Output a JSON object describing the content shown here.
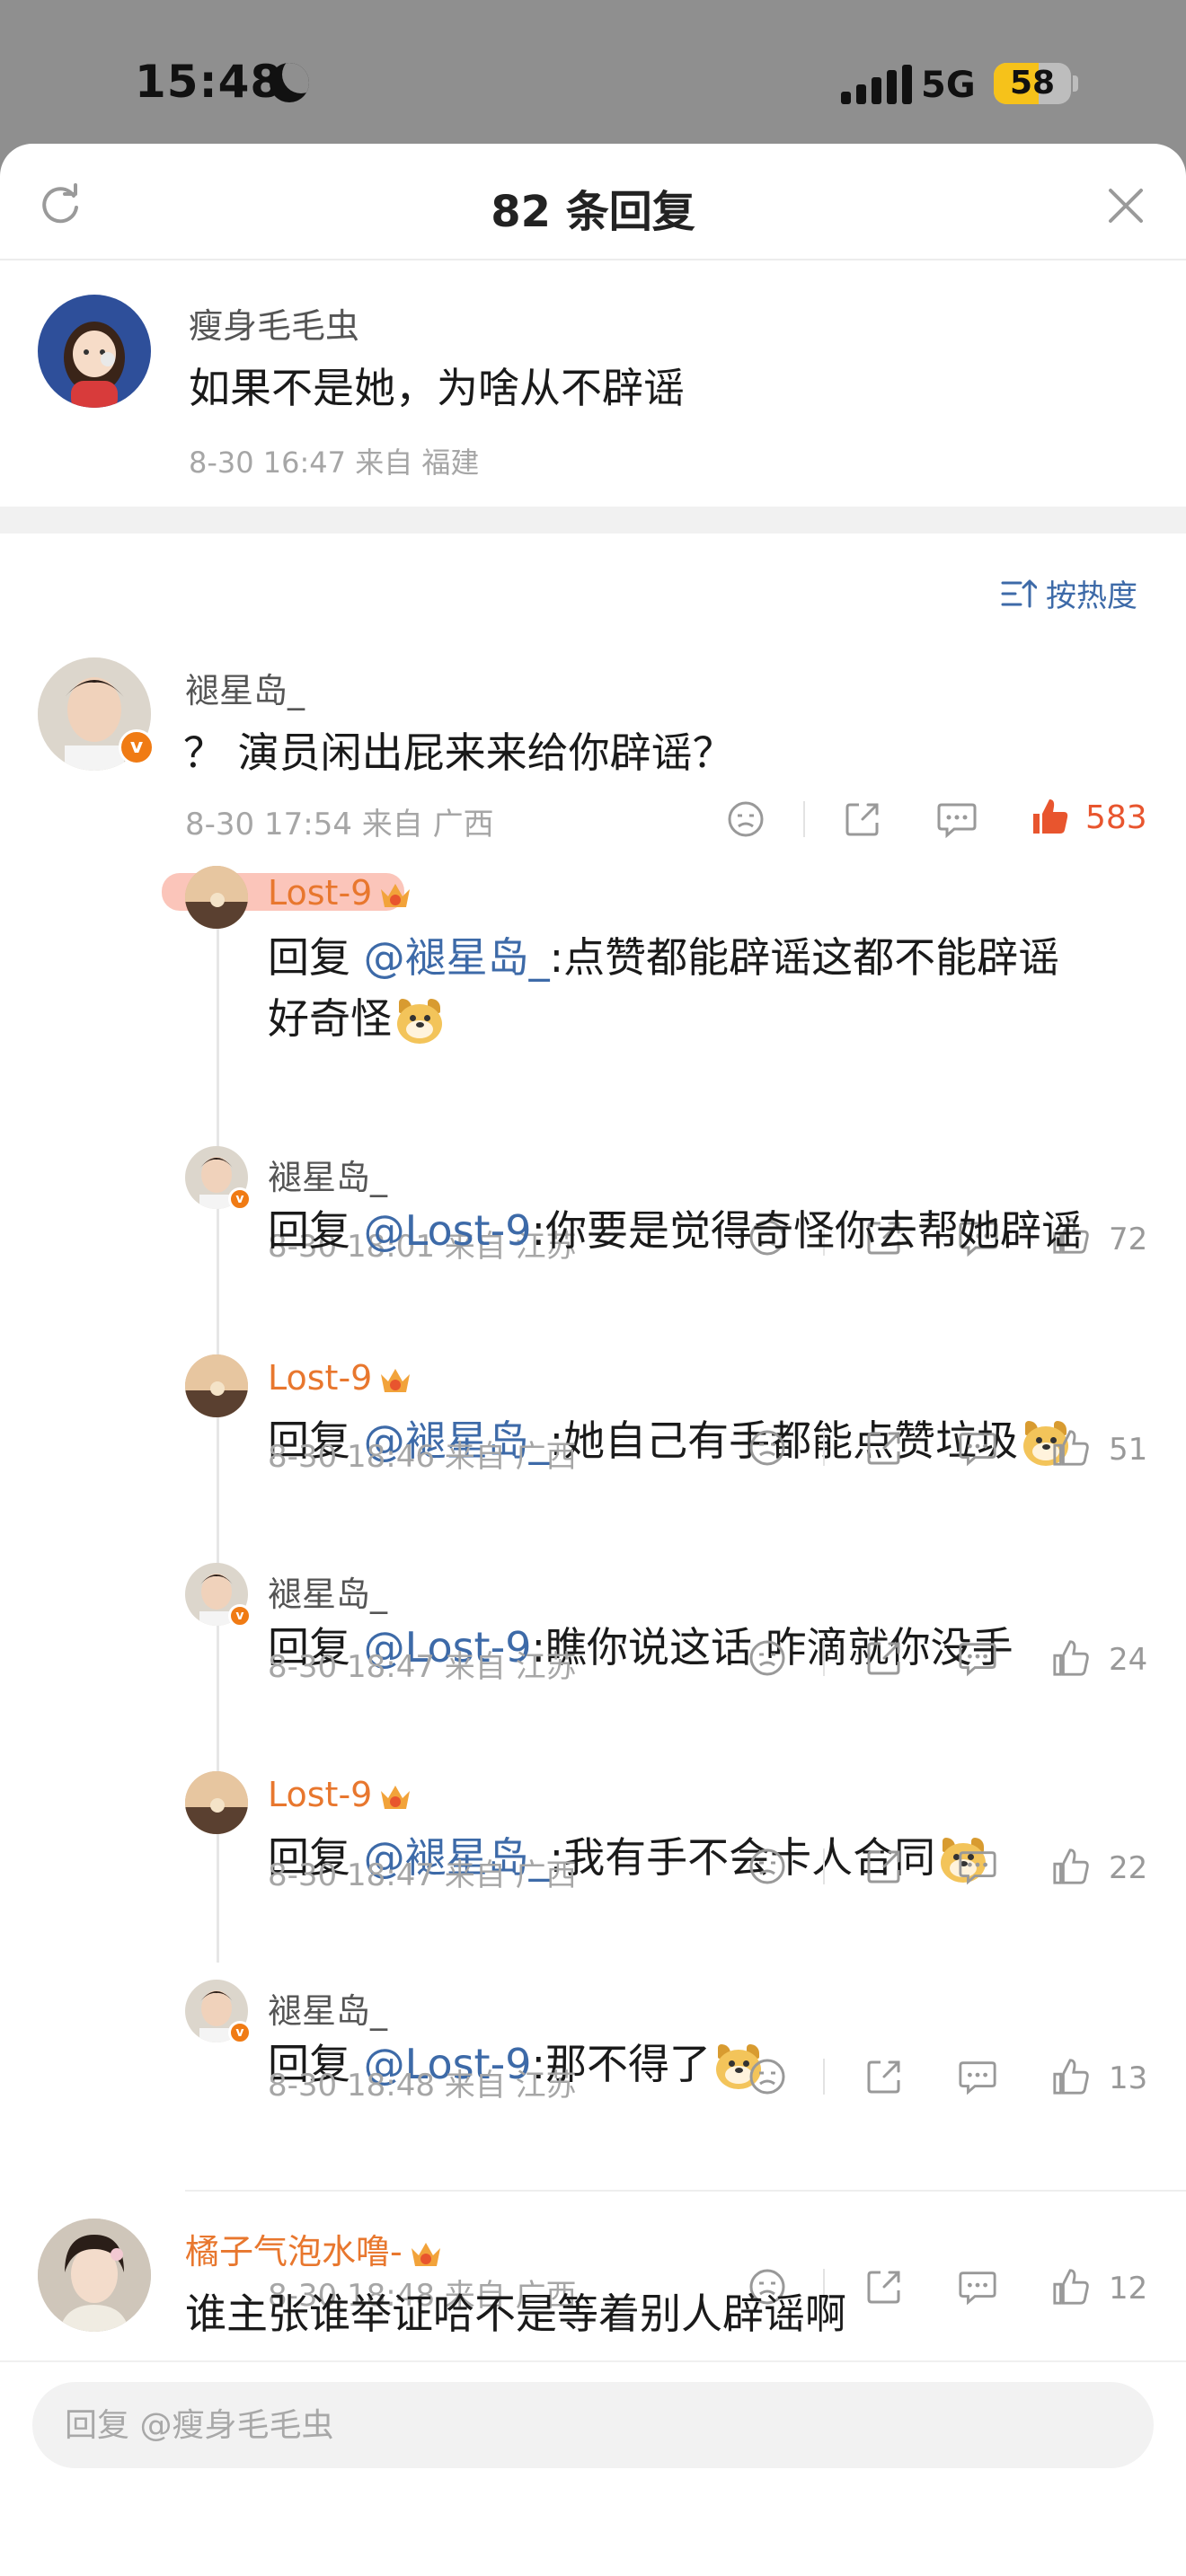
{
  "status_bar": {
    "time": "15:48",
    "network": "5G",
    "battery": "58",
    "battery_level": 0.58
  },
  "header": {
    "title": "82 条回复"
  },
  "root_comment": {
    "user": "瘦身毛毛虫",
    "text": "如果不是她，为啥从不辟谣",
    "meta": "8-30 16:47 来自 福建"
  },
  "sort": {
    "label": "按热度"
  },
  "top_comment": {
    "user": "褪星岛_",
    "text": "？ 演员闲出屁来来给你辟谣？",
    "meta": "8-30 17:54 来自 广西",
    "likes": "583"
  },
  "replies": [
    {
      "user": "Lost-9",
      "prefix": "回复 ",
      "at": "@褪星岛_",
      "text_line1": ":点赞都能辟谣这都不能辟谣",
      "text_line2": "好奇怪",
      "meta": "8-30 18:01 来自 江苏",
      "likes": "72"
    },
    {
      "user": "褪星岛_",
      "prefix": "回复 ",
      "at": "@Lost-9",
      "text": ":你要是觉得奇怪你去帮她辟谣",
      "meta": "8-30 18:46 来自 广西",
      "likes": "51"
    },
    {
      "user": "Lost-9",
      "prefix": "回复 ",
      "at": "@褪星岛_",
      "text": ":她自己有手都能点赞垃圾",
      "meta": "8-30 18:47 来自 江苏",
      "likes": "24"
    },
    {
      "user": "褪星岛_",
      "prefix": "回复 ",
      "at": "@Lost-9",
      "text": ":瞧你说这话 咋滴就你没手",
      "meta": "8-30 18:47 来自 广西",
      "likes": "22"
    },
    {
      "user": "Lost-9",
      "prefix": "回复 ",
      "at": "@褪星岛_",
      "text": ":我有手不会卡人合同",
      "meta": "8-30 18:48 来自 江苏",
      "likes": "13"
    },
    {
      "user": "褪星岛_",
      "prefix": "回复 ",
      "at": "@Lost-9",
      "text": ":那不得了",
      "meta": "8-30 18:48 来自 广西",
      "likes": "12"
    }
  ],
  "next_comment": {
    "user": "橘子气泡水噜-",
    "text": "谁主张谁举证哈不是等着别人辟谣啊"
  },
  "reply_input": {
    "placeholder": "回复 @瘦身毛毛虫"
  },
  "colors": {
    "accent_orange": "#e8772e",
    "mention_blue": "#3d6aa8",
    "like_red": "#e8552e",
    "meta_gray": "#a6a6a6"
  }
}
